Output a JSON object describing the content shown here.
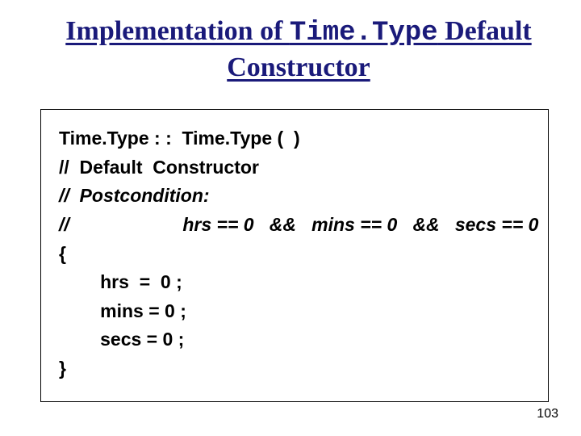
{
  "title": {
    "pre": "Implementation of ",
    "mono": "Time.Type",
    "post": " Default Constructor"
  },
  "code": {
    "l1": "Time.Type : :  Time.Type (  )",
    "l2": "//  Default  Constructor",
    "l3": "//  Postcondition:",
    "l4": "//                      hrs == 0   &&   mins == 0   &&   secs == 0",
    "l5": "{",
    "l6": "        hrs  =  0 ;",
    "l7": "        mins = 0 ;",
    "l8": "        secs = 0 ;",
    "l9": "}"
  },
  "page_number": "103"
}
